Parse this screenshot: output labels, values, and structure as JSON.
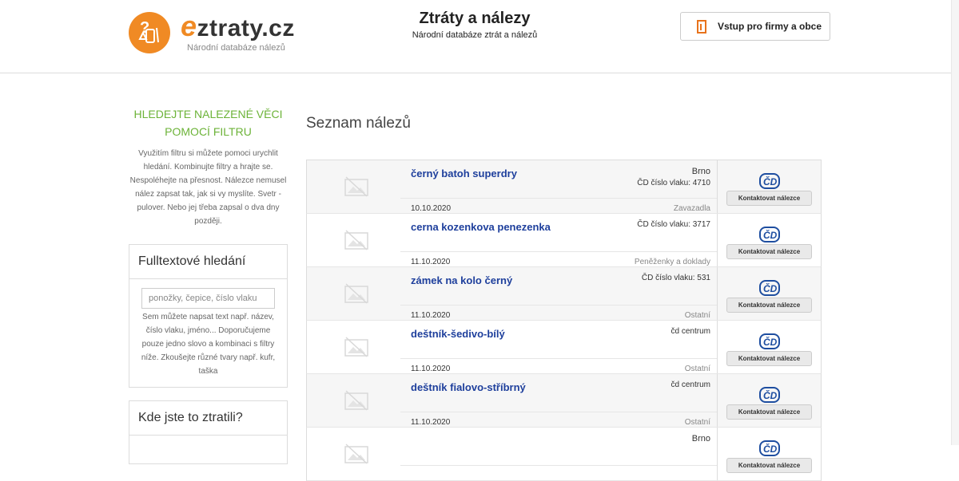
{
  "header": {
    "logo_letter": "e",
    "logo_rest": "ztraty.cz",
    "logo_sub": "Národní databáze nálezů",
    "title": "Ztráty a nálezy",
    "subtitle": "Národní databáze ztrát a nálezů",
    "firm_button": "Vstup pro firmy a obce",
    "brand_color": "#f08a24"
  },
  "sidebar": {
    "heading": "HLEDEJTE NALEZENÉ VĚCI POMOCÍ FILTRU",
    "intro": "Využitím filtru si můžete pomoci urychlit hledání. Kombinujte filtry a hrajte se. Nespoléhejte na přesnost. Nálezce nemusel nález zapsat tak, jak si vy myslíte. Svetr - pulover. Nebo jej třeba zapsal o dva dny později.",
    "fulltext": {
      "title": "Fulltextové hledání",
      "placeholder": "ponožky, čepice, číslo vlaku",
      "value": "",
      "help": "Sem můžete napsat text např. název, číslo vlaku, jméno... Doporučujeme pouze jedno slovo a kombinaci s filtry níže. Zkoušejte různé tvary např. kufr, taška"
    },
    "where_title": "Kde jste to ztratili?",
    "heading_color": "#6cb338"
  },
  "main": {
    "title": "Seznam nálezů",
    "contact_label": "Kontaktovat nálezce",
    "items": [
      {
        "name": "černý batoh superdry",
        "city": "Brno",
        "train": "ČD číslo vlaku: 4710",
        "date": "10.10.2020",
        "category": "Zavazadla"
      },
      {
        "name": "cerna kozenkova penezenka",
        "city": "",
        "train": "ČD číslo vlaku: 3717",
        "date": "11.10.2020",
        "category": "Peněženky a doklady"
      },
      {
        "name": "zámek na kolo černý",
        "city": "",
        "train": "ČD číslo vlaku: 531",
        "date": "11.10.2020",
        "category": "Ostatní"
      },
      {
        "name": "deštník-šedivo-bílý",
        "city": "",
        "train": "čd centrum",
        "date": "11.10.2020",
        "category": "Ostatní"
      },
      {
        "name": "deštník fialovo-stříbrný",
        "city": "",
        "train": "čd centrum",
        "date": "11.10.2020",
        "category": "Ostatní"
      },
      {
        "name": "",
        "city": "Brno",
        "train": "",
        "date": "",
        "category": ""
      }
    ],
    "link_color": "#1e3f9c"
  }
}
